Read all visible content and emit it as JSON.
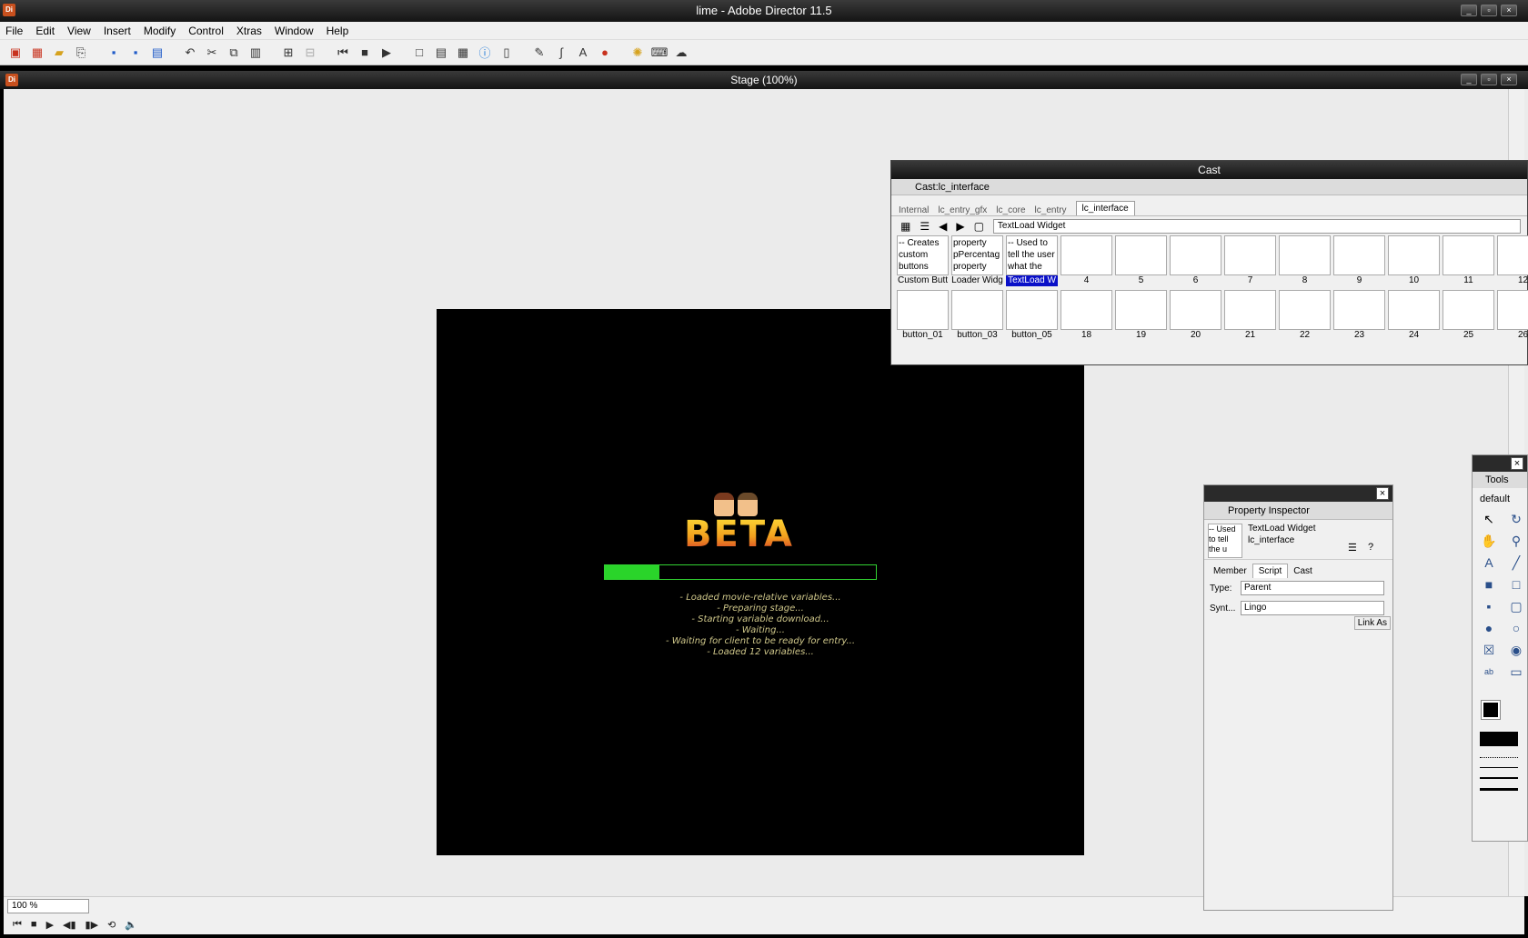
{
  "app": {
    "title": "lime - Adobe Director 11.5",
    "logo": "Di"
  },
  "menu": [
    "File",
    "Edit",
    "View",
    "Insert",
    "Modify",
    "Control",
    "Xtras",
    "Window",
    "Help"
  ],
  "toolbar_icons": [
    "new-movie-icon",
    "new-cast-icon",
    "open-icon",
    "import-icon",
    "save-icon",
    "save-all-icon",
    "publish-icon",
    "undo-icon",
    "cut-icon",
    "copy-icon",
    "paste-icon",
    "find-icon",
    "replace-icon",
    "rewind-icon",
    "stop-icon",
    "play-icon",
    "stage-icon",
    "score-icon",
    "cast-window-icon",
    "property-inspector-icon",
    "library-icon",
    "paint-icon",
    "vector-icon",
    "text-icon",
    "color-icon",
    "xtras-icon",
    "help-icon",
    "chat-icon"
  ],
  "stage": {
    "title": "Stage (100%)",
    "zoom": "100 %",
    "movie": {
      "logo_text": "BETA",
      "progress": 0.2,
      "log": [
        "- Loaded movie-relative variables...",
        "- Preparing stage...",
        "- Starting variable download...",
        "- Waiting...",
        "- Waiting for client to be ready for entry...",
        "- Loaded 12 variables..."
      ]
    }
  },
  "cast": {
    "title": "Cast",
    "name": "Cast:lc_interface",
    "tabs": [
      "Internal",
      "lc_entry_gfx",
      "lc_core",
      "lc_entry",
      "lc_interface"
    ],
    "active_tab": "lc_interface",
    "member_field": "TextLoad Widget",
    "row1": [
      {
        "thumb": "-- Creates custom buttons",
        "label": "Custom Butt"
      },
      {
        "thumb": "property pPercentag property",
        "label": "Loader Widg"
      },
      {
        "thumb": "-- Used to tell the user what the",
        "label": "TextLoad W",
        "selected": true
      },
      {
        "thumb": "",
        "label": "4"
      },
      {
        "thumb": "",
        "label": "5"
      },
      {
        "thumb": "",
        "label": "6"
      },
      {
        "thumb": "",
        "label": "7"
      },
      {
        "thumb": "",
        "label": "8"
      },
      {
        "thumb": "",
        "label": "9"
      },
      {
        "thumb": "",
        "label": "10"
      },
      {
        "thumb": "",
        "label": "11"
      },
      {
        "thumb": "",
        "label": "12"
      }
    ],
    "row2": [
      {
        "thumb": "",
        "label": "button_01"
      },
      {
        "thumb": "",
        "label": "button_03"
      },
      {
        "thumb": "",
        "label": "button_05"
      },
      {
        "thumb": "",
        "label": "18"
      },
      {
        "thumb": "",
        "label": "19"
      },
      {
        "thumb": "",
        "label": "20"
      },
      {
        "thumb": "",
        "label": "21"
      },
      {
        "thumb": "",
        "label": "22"
      },
      {
        "thumb": "",
        "label": "23"
      },
      {
        "thumb": "",
        "label": "24"
      },
      {
        "thumb": "",
        "label": "25"
      },
      {
        "thumb": "",
        "label": "26"
      }
    ]
  },
  "property_inspector": {
    "title": "Property Inspector",
    "thumb_text": "-- Used to tell the u",
    "member_name": "TextLoad Widget",
    "cast_name": "lc_interface",
    "tabs": [
      "Member",
      "Script",
      "Cast"
    ],
    "active_tab": "Script",
    "type_label": "Type:",
    "type_value": "Parent",
    "syntax_label": "Synt...",
    "syntax_value": "Lingo",
    "link_button": "Link As"
  },
  "tools": {
    "title": "Tools",
    "preset": "default"
  }
}
